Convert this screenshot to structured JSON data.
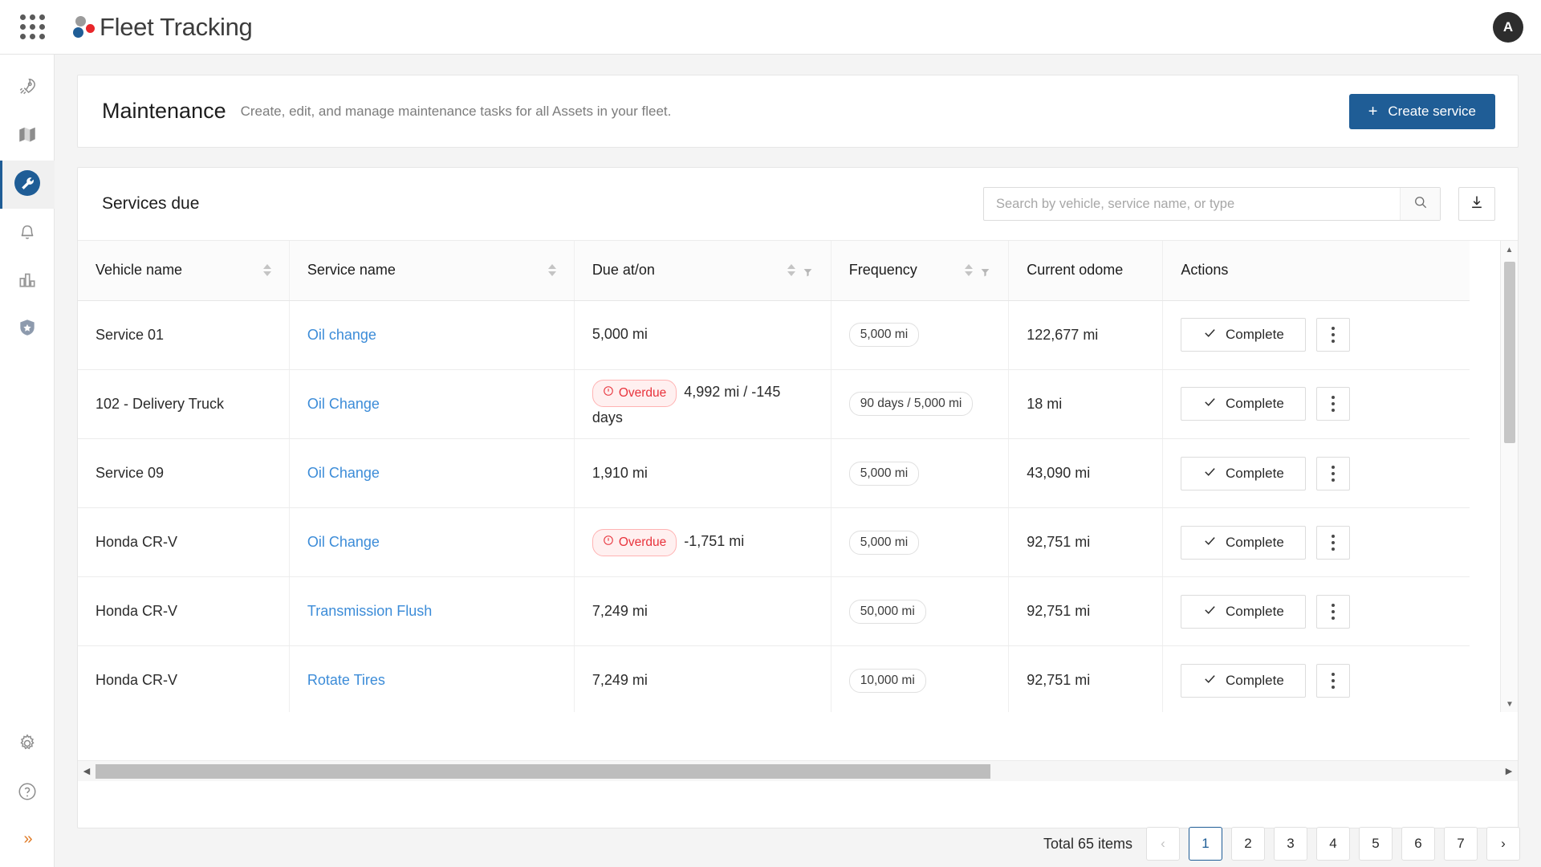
{
  "app": {
    "brand_name": "Fleet Tracking",
    "apps_menu_icon": "apps-grid-icon",
    "avatar_initial": "A",
    "accent_blue": "#1f5d96",
    "link_blue": "#3c8cd8",
    "overdue_red": "#e8333c",
    "expand_orange": "#e07b26"
  },
  "sidebar": {
    "items": [
      {
        "icon": "rocket-icon",
        "name": "rocket",
        "active": false
      },
      {
        "icon": "map-icon",
        "name": "map",
        "active": false
      },
      {
        "icon": "wrench-icon",
        "name": "maintenance",
        "active": true
      },
      {
        "icon": "bell-icon",
        "name": "alerts",
        "active": false
      },
      {
        "icon": "bar-chart-icon",
        "name": "reports",
        "active": false
      },
      {
        "icon": "shield-star-icon",
        "name": "safety",
        "active": false
      }
    ],
    "bottom_items": [
      {
        "icon": "gear-icon",
        "name": "settings"
      },
      {
        "icon": "help-circle-icon",
        "name": "help"
      }
    ],
    "expand_label": "»"
  },
  "header": {
    "title": "Maintenance",
    "subtitle": "Create, edit, and manage maintenance tasks for all Assets in your fleet.",
    "create_button": {
      "label": "Create service",
      "plus": "+"
    }
  },
  "toolbar": {
    "section_title": "Services due",
    "search_placeholder": "Search by vehicle, service name, or type",
    "search_value": "",
    "search_icon": "magnifier-icon",
    "download_icon": "download-icon"
  },
  "table": {
    "columns": [
      {
        "label": "Vehicle name",
        "sortable": true,
        "filterable": false
      },
      {
        "label": "Service name",
        "sortable": true,
        "filterable": false
      },
      {
        "label": "Due at/on",
        "sortable": true,
        "filterable": true
      },
      {
        "label": "Frequency",
        "sortable": true,
        "filterable": true
      },
      {
        "label": "Current odome",
        "sortable": false,
        "filterable": false
      },
      {
        "label": "Actions",
        "sortable": false,
        "filterable": false
      }
    ],
    "rows": [
      {
        "vehicle": "Service 01",
        "service": "Oil change",
        "due_badge": "",
        "due": "5,000 mi",
        "frequency": "5,000 mi",
        "odometer": "122,677 mi",
        "action_label": "Complete"
      },
      {
        "vehicle": "102 - Delivery Truck",
        "service": "Oil Change",
        "due_badge": "Overdue",
        "due": "4,992 mi / -145 days",
        "frequency": "90 days / 5,000 mi",
        "odometer": "18 mi",
        "action_label": "Complete"
      },
      {
        "vehicle": "Service 09",
        "service": "Oil Change",
        "due_badge": "",
        "due": "1,910 mi",
        "frequency": "5,000 mi",
        "odometer": "43,090 mi",
        "action_label": "Complete"
      },
      {
        "vehicle": "Honda CR-V",
        "service": "Oil Change",
        "due_badge": "Overdue",
        "due": "-1,751 mi",
        "frequency": "5,000 mi",
        "odometer": "92,751 mi",
        "action_label": "Complete"
      },
      {
        "vehicle": "Honda CR-V",
        "service": "Transmission Flush",
        "due_badge": "",
        "due": "7,249 mi",
        "frequency": "50,000 mi",
        "odometer": "92,751 mi",
        "action_label": "Complete"
      },
      {
        "vehicle": "Honda CR-V",
        "service": "Rotate Tires",
        "due_badge": "",
        "due": "7,249 mi",
        "frequency": "10,000 mi",
        "odometer": "92,751 mi",
        "action_label": "Complete"
      }
    ],
    "action_check_icon": "check-icon",
    "row_menu_icon": "kebab-menu-icon"
  },
  "pagination": {
    "total_text": "Total 65 items",
    "prev": "‹",
    "next": "›",
    "pages": [
      "1",
      "2",
      "3",
      "4",
      "5",
      "6",
      "7"
    ],
    "current": "1"
  }
}
